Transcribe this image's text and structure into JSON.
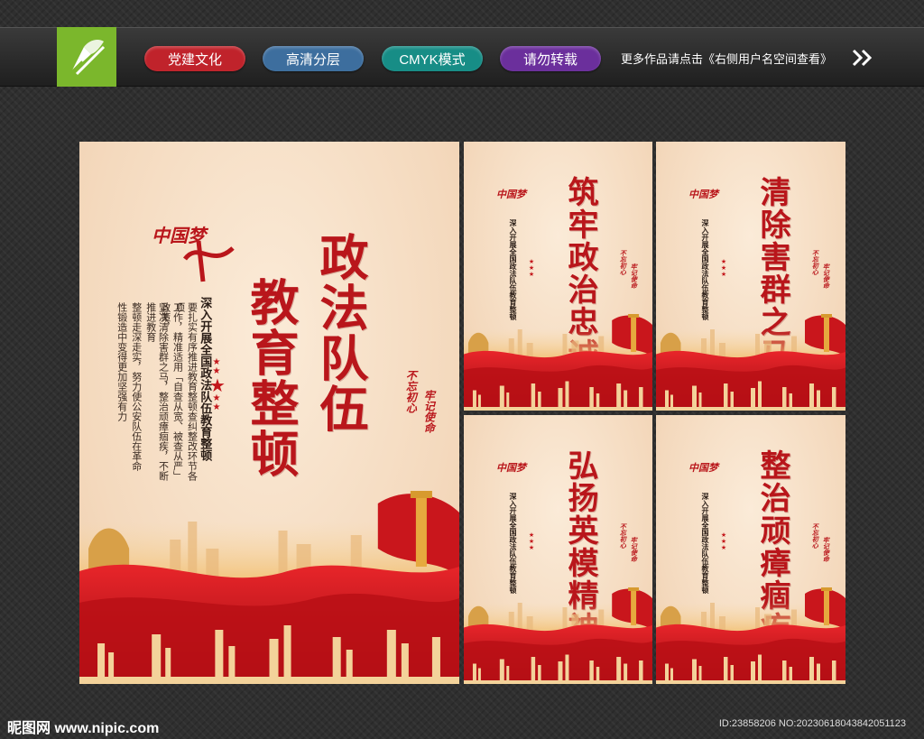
{
  "header": {
    "tags": [
      {
        "label": "党建文化",
        "color": "#c0232b"
      },
      {
        "label": "高清分层",
        "color": "#3d6e9e"
      },
      {
        "label": "CMYK模式",
        "color": "#178d86"
      },
      {
        "label": "请勿转载",
        "color": "#6b2f9c"
      }
    ],
    "more_text": "更多作品请点击《右侧用户名空间查看》"
  },
  "main_poster": {
    "logo_text": "中国梦",
    "title_col1": "政法队伍",
    "title_col2": "教育整顿",
    "subtitle": "深入开展全国政法队伍教育整顿",
    "body": [
      "要扎实有序推进教育整顿查纠整改环节各项",
      "工作，精准适用「自查从宽、被查从严」政策，",
      "坚决清除害群之马，整治顽瘴痼疾，不断推进教育",
      "整顿走深走实，努力使公安队伍在革命",
      "性锻造中变得更加坚强有力"
    ],
    "slogan_left": "不忘初心",
    "slogan_right": "牢记使命"
  },
  "small_posters": [
    {
      "title": "筑牢政治忠诚",
      "subtitle": "深入开展全国政法队伍教育整顿",
      "slogan_left": "不忘初心",
      "slogan_right": "牢记使命"
    },
    {
      "title": "清除害群之马",
      "subtitle": "深入开展全国政法队伍教育整顿",
      "slogan_left": "不忘初心",
      "slogan_right": "牢记使命"
    },
    {
      "title": "弘扬英模精神",
      "subtitle": "深入开展全国政法队伍教育整顿",
      "slogan_left": "不忘初心",
      "slogan_right": "牢记使命"
    },
    {
      "title": "整治顽瘴痼疾",
      "subtitle": "深入开展全国政法队伍教育整顿",
      "slogan_left": "不忘初心",
      "slogan_right": "牢记使命"
    }
  ],
  "footer": {
    "site": "昵图网 www.nipic.com",
    "id_text": "ID:23858206 NO:20230618043842051123"
  },
  "colors": {
    "red": "#b9161b",
    "cream": "#f6dfc6",
    "gold": "#e0a53a"
  }
}
